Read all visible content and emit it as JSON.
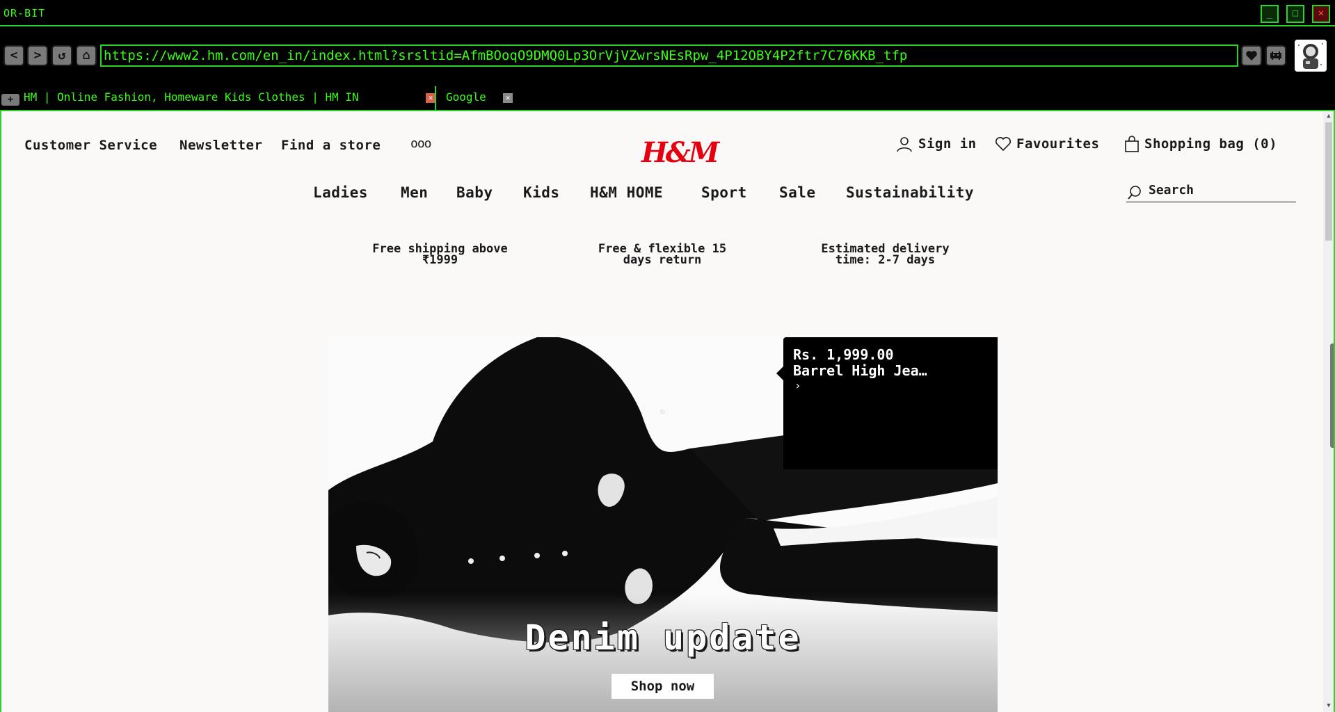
{
  "window": {
    "title": "OR-BIT",
    "min_label": "_",
    "max_label": "□",
    "close_label": "✕"
  },
  "nav": {
    "back": "<",
    "forward": ">",
    "reload": "↺",
    "home": "⌂",
    "url": "https://www2.hm.com/en_in/index.html?srsltid=AfmBOoqO9DMQ0Lp3OrVjVZwrsNEsRpw_4P12OBY4P2ftr7C76KKB_tfp",
    "bookmark_icon": "heart-icon",
    "extension_icon": "space-invader-icon"
  },
  "tabs": {
    "new_tab_label": "+",
    "items": [
      {
        "label": "HM | Online Fashion, Homeware  Kids Clothes | HM IN",
        "close": "✕"
      },
      {
        "label": "Google",
        "close": "✕"
      }
    ]
  },
  "page": {
    "utility_links": [
      "Customer Service",
      "Newsletter",
      "Find a store"
    ],
    "more_label": "ooo",
    "logo": "H&M",
    "account": {
      "sign_in": "Sign in",
      "favourites": "Favourites",
      "bag": "Shopping bag (0)"
    },
    "categories": [
      "Ladies",
      "Men",
      "Baby",
      "Kids",
      "H&M HOME",
      "Sport",
      "Sale",
      "Sustainability"
    ],
    "search": {
      "label": "Search"
    },
    "usps": [
      {
        "line1": "Free shipping above",
        "line2": "₹1999"
      },
      {
        "line1": "Free & flexible 15",
        "line2": "days return"
      },
      {
        "line1": "Estimated delivery",
        "line2": "time: 2-7 days"
      }
    ],
    "hero": {
      "price": "Rs. 1,999.00",
      "product": "Barrel High Jea…",
      "chevron": "›",
      "title": "Denim update",
      "cta": "Shop now"
    }
  },
  "colors": {
    "accent_green": "#39ff14",
    "brand_red": "#e50010"
  }
}
